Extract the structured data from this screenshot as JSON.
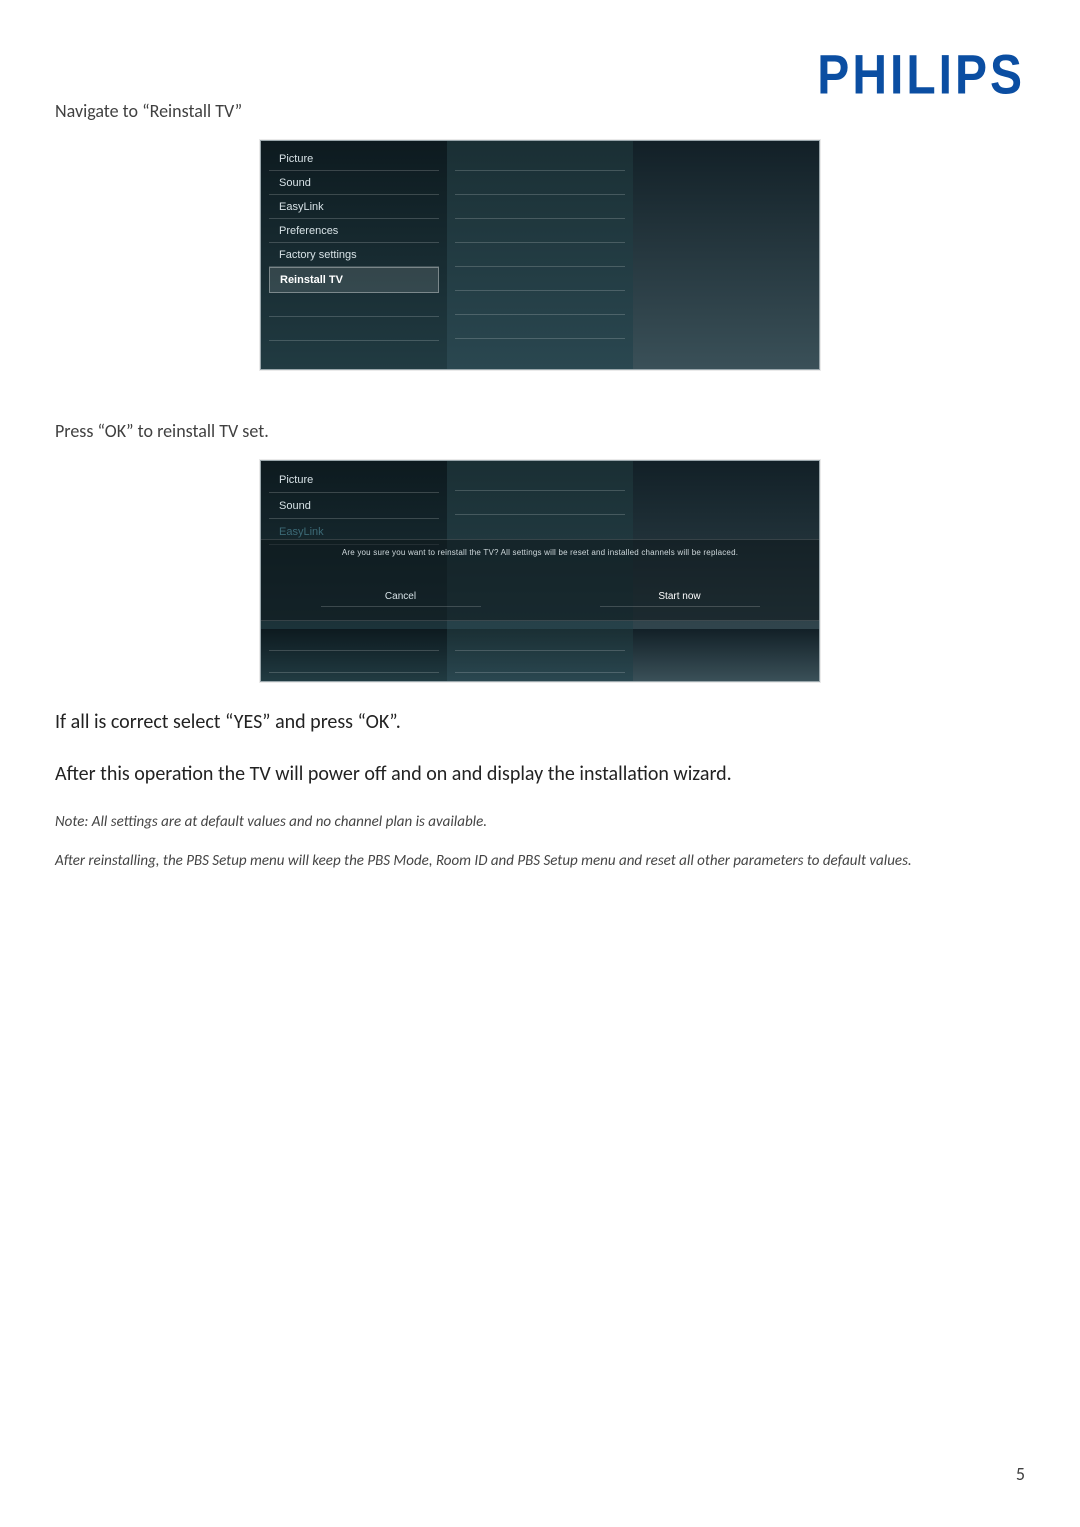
{
  "logo_text": "PHILIPS",
  "text": {
    "nav_instruction": "Navigate to “Reinstall TV”",
    "press_ok": "Press “OK” to reinstall TV set.",
    "if_correct": "If all is correct select “YES” and press “OK”.",
    "after_op": "After this operation the TV will power off and on and display the installation wizard.",
    "note1": "Note: All settings are at default values and no channel plan is available.",
    "note2": "After reinstalling, the PBS Setup menu will keep the PBS Mode, Room ID and PBS Setup menu and reset all other parameters to default values."
  },
  "shot1": {
    "menu_items": [
      "Picture",
      "Sound",
      "EasyLink",
      "Preferences",
      "Factory settings",
      "Reinstall TV"
    ],
    "selected_index": 5
  },
  "shot2": {
    "menu_items_top": [
      "Picture",
      "Sound",
      "EasyLink"
    ],
    "dialog_message": "Are you sure you want to reinstall the TV? All settings will be reset and installed channels will be replaced.",
    "buttons": {
      "cancel": "Cancel",
      "start": "Start now"
    }
  },
  "page_number": "5"
}
